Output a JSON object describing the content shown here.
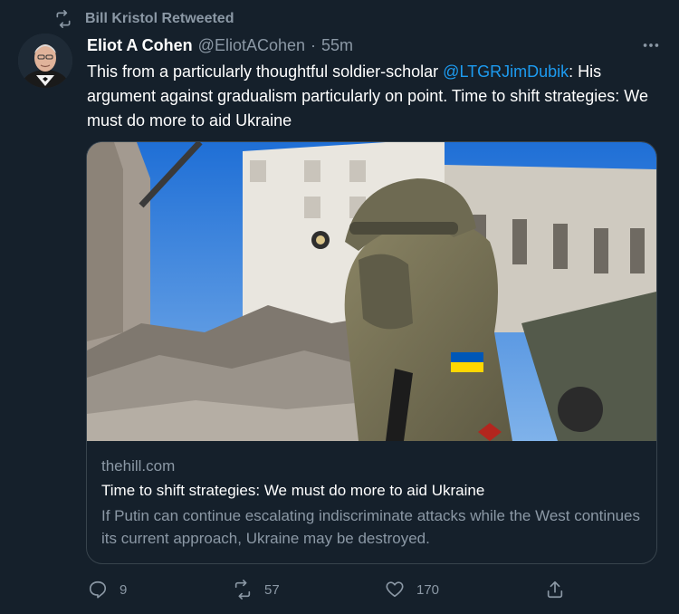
{
  "retweet_header": {
    "label": "Bill Kristol Retweeted",
    "icon": "retweet-icon"
  },
  "author": {
    "name": "Eliot A Cohen",
    "handle": "@EliotACohen",
    "separator": "·",
    "time": "55m"
  },
  "tweet": {
    "text_before": "This from a particularly thoughtful soldier-scholar ",
    "mention": "@LTGRJimDubik",
    "text_after": ": His argument against gradualism particularly on point.  Time to shift strategies: We must do more to aid Ukraine"
  },
  "card": {
    "domain": "thehill.com",
    "title": "Time to shift strategies: We must do more to aid Ukraine",
    "description": "If Putin can continue escalating indiscriminate attacks while the West continues its current approach, Ukraine may be destroyed."
  },
  "actions": {
    "reply_count": "9",
    "retweet_count": "57",
    "like_count": "170"
  },
  "colors": {
    "background": "#15202b",
    "secondary_text": "#8b98a5",
    "link": "#1d9bf0",
    "card_border": "#38444d"
  }
}
